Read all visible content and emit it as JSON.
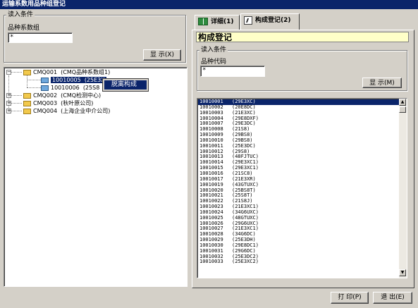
{
  "window": {
    "title": "运输系数用品种组登记"
  },
  "left": {
    "search_group": {
      "legend": "读入条件",
      "field_label": "品种系数组",
      "field_value": "*",
      "display_button": "显 示(X)"
    },
    "tree": [
      {
        "code": "CMQ001",
        "name": "(CMQ品种系数组1)"
      },
      {
        "code": "10010005",
        "name": "(25E3X"
      },
      {
        "code": "10010006",
        "name": "(25S8"
      },
      {
        "code": "CMQ002",
        "name": "(CMQ检测中心)"
      },
      {
        "code": "CMQ003",
        "name": "(秋叶原公司)"
      },
      {
        "code": "CMQ004",
        "name": "(上海企业中介公司)"
      }
    ],
    "context_menu": {
      "item": "脱离构成"
    }
  },
  "right": {
    "tabs": [
      {
        "label": "详细(1)"
      },
      {
        "label": "构成登记(2)"
      }
    ],
    "section_title": "构成登记",
    "search_group": {
      "legend": "读入条件",
      "field_label": "品种代码",
      "field_value": "*",
      "display_button": "显 示(M)"
    },
    "list": [
      {
        "code": "10010001",
        "name": "(29E3XC)"
      },
      {
        "code": "10010002",
        "name": "(20E8DC)"
      },
      {
        "code": "10010003",
        "name": "(21E3XC)"
      },
      {
        "code": "10010004",
        "name": "(29E8DXF)"
      },
      {
        "code": "10010007",
        "name": "(29E3DC)"
      },
      {
        "code": "10010008",
        "name": "(21S8)"
      },
      {
        "code": "10010009",
        "name": "(29BS8)"
      },
      {
        "code": "10010010",
        "name": "(29BS8)"
      },
      {
        "code": "10010011",
        "name": "(25E3DC)"
      },
      {
        "code": "10010012",
        "name": "(29S8)"
      },
      {
        "code": "10010013",
        "name": "(48FJTUC)"
      },
      {
        "code": "10010014",
        "name": "(29E3XC1)"
      },
      {
        "code": "10010015",
        "name": "(29E3XC1)"
      },
      {
        "code": "10010016",
        "name": "(21SC8)"
      },
      {
        "code": "10010017",
        "name": "(21E3XR)"
      },
      {
        "code": "10010019",
        "name": "(43GTUXC)"
      },
      {
        "code": "10010020",
        "name": "(25BS8T)"
      },
      {
        "code": "10010021",
        "name": "(25S8T)"
      },
      {
        "code": "10010022",
        "name": "(21S8J)"
      },
      {
        "code": "10010023",
        "name": "(21E3XC1)"
      },
      {
        "code": "10010024",
        "name": "(34G6UXC)"
      },
      {
        "code": "10010025",
        "name": "(48GTUXC)"
      },
      {
        "code": "10010026",
        "name": "(29G6UXC)"
      },
      {
        "code": "10010027",
        "name": "(21E3XC1)"
      },
      {
        "code": "10010028",
        "name": "(34G6DC)"
      },
      {
        "code": "10010029",
        "name": "(25E3DH)"
      },
      {
        "code": "10010030",
        "name": "(29E8DC1)"
      },
      {
        "code": "10010031",
        "name": "(29G6DC)"
      },
      {
        "code": "10010032",
        "name": "(25E3DC2)"
      },
      {
        "code": "10010033",
        "name": "(25E3XC2)"
      }
    ],
    "selected_index": 0
  },
  "footer": {
    "print_button": "打 印(P)",
    "exit_button": "退 出(E)"
  }
}
